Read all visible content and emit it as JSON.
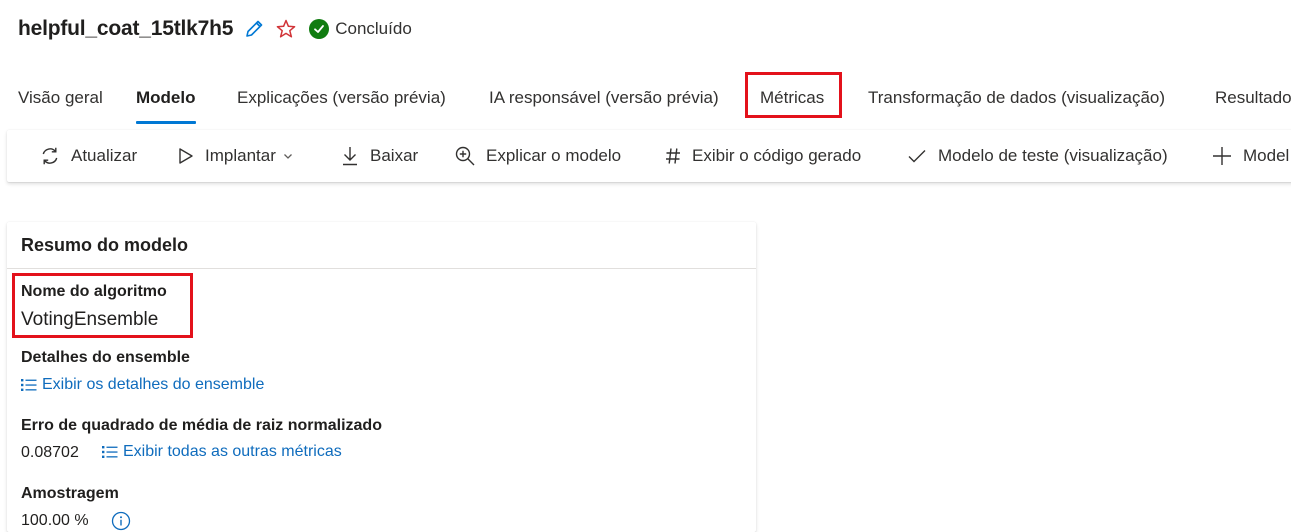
{
  "header": {
    "run_name": "helpful_coat_15tlk7h5",
    "status": "Concluído"
  },
  "tabs": [
    {
      "label": "Visão geral"
    },
    {
      "label": "Modelo"
    },
    {
      "label": "Explicações (versão prévia)"
    },
    {
      "label": "IA responsável (versão prévia)"
    },
    {
      "label": "Métricas"
    },
    {
      "label": "Transformação de dados (visualização)"
    },
    {
      "label": "Resultado"
    }
  ],
  "toolbar": {
    "refresh": "Atualizar",
    "deploy": "Implantar",
    "download": "Baixar",
    "explain": "Explicar o modelo",
    "view_code": "Exibir o código gerado",
    "test_model": "Modelo de teste (visualização)",
    "register": "Model"
  },
  "summary": {
    "title": "Resumo do modelo",
    "algorithm_label": "Nome do algoritmo",
    "algorithm_value": "VotingEnsemble",
    "ensemble_label": "Detalhes do ensemble",
    "ensemble_link": "Exibir os detalhes do ensemble",
    "metric_label": "Erro de quadrado de média de raiz normalizado",
    "metric_value": "0.08702",
    "metric_link": "Exibir todas as outras métricas",
    "sampling_label": "Amostragem",
    "sampling_value": "100.00 %"
  },
  "colors": {
    "accent": "#0078d4",
    "link": "#0f6cbd",
    "success": "#107c10",
    "highlight": "#e3111b"
  }
}
